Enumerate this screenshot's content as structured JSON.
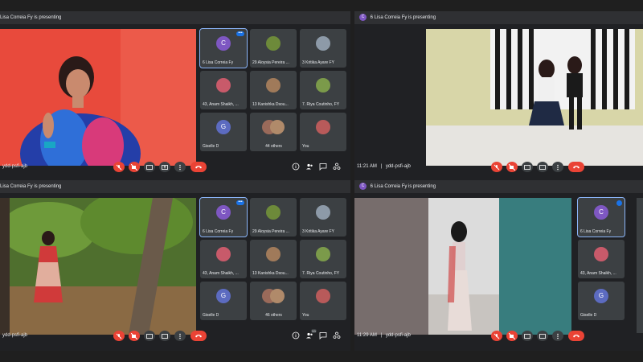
{
  "windows": [
    {
      "title": "Lisa Correia Fy is presenting",
      "meeting_code": "ydd-psfi-ajb",
      "time": "",
      "tiles": [
        "6 Lisa Correia Fy",
        "29 Aloysia Pereira ...",
        "3 Kritika Ayare FY",
        "43, Anam Shaikh, ...",
        "13 Kanishka Dsou...",
        "7. Riya Coutinho, FY",
        "Giselle D",
        "44 others",
        "You"
      ],
      "people_badge": ""
    },
    {
      "title": "6 Lisa Correia Fy is presenting",
      "meeting_code": "ydd-psfi-ajb",
      "time": "11:21 AM",
      "tiles": [],
      "people_badge": ""
    },
    {
      "title": "Lisa Correia Fy is presenting",
      "meeting_code": "ydd-psfi-ajb",
      "time": "",
      "tiles": [
        "6 Lisa Correia Fy",
        "29 Aloysia Pereira ...",
        "3 Kritika Ayare FY",
        "43, Anam Shaikh, ...",
        "13 Kanishka Dsou...",
        "7. Riya Coutinho, FY",
        "Giselle D",
        "46 others",
        "You"
      ],
      "people_badge": "53"
    },
    {
      "title": "6 Lisa Correia Fy is presenting",
      "meeting_code": "ydd-psfi-ajb",
      "time": "11:29 AM",
      "tiles": [
        "6 Lisa Correia Fy",
        "43, Anam Shaikh, ...",
        "Giselle D"
      ],
      "people_badge": ""
    }
  ],
  "avatar_letters": {
    "lisa": "C",
    "giselle": "G"
  },
  "colors": {
    "lisa_avatar": "#7e57c2",
    "giselle_avatar": "#5c6bc0",
    "hangup": "#ea4335",
    "highlight": "#8ab4f8"
  },
  "icons": [
    "mic-off-icon",
    "camera-off-icon",
    "captions-icon",
    "present-icon",
    "more-vert-icon",
    "hang-up-icon",
    "info-icon",
    "people-icon",
    "chat-icon",
    "activities-icon"
  ]
}
